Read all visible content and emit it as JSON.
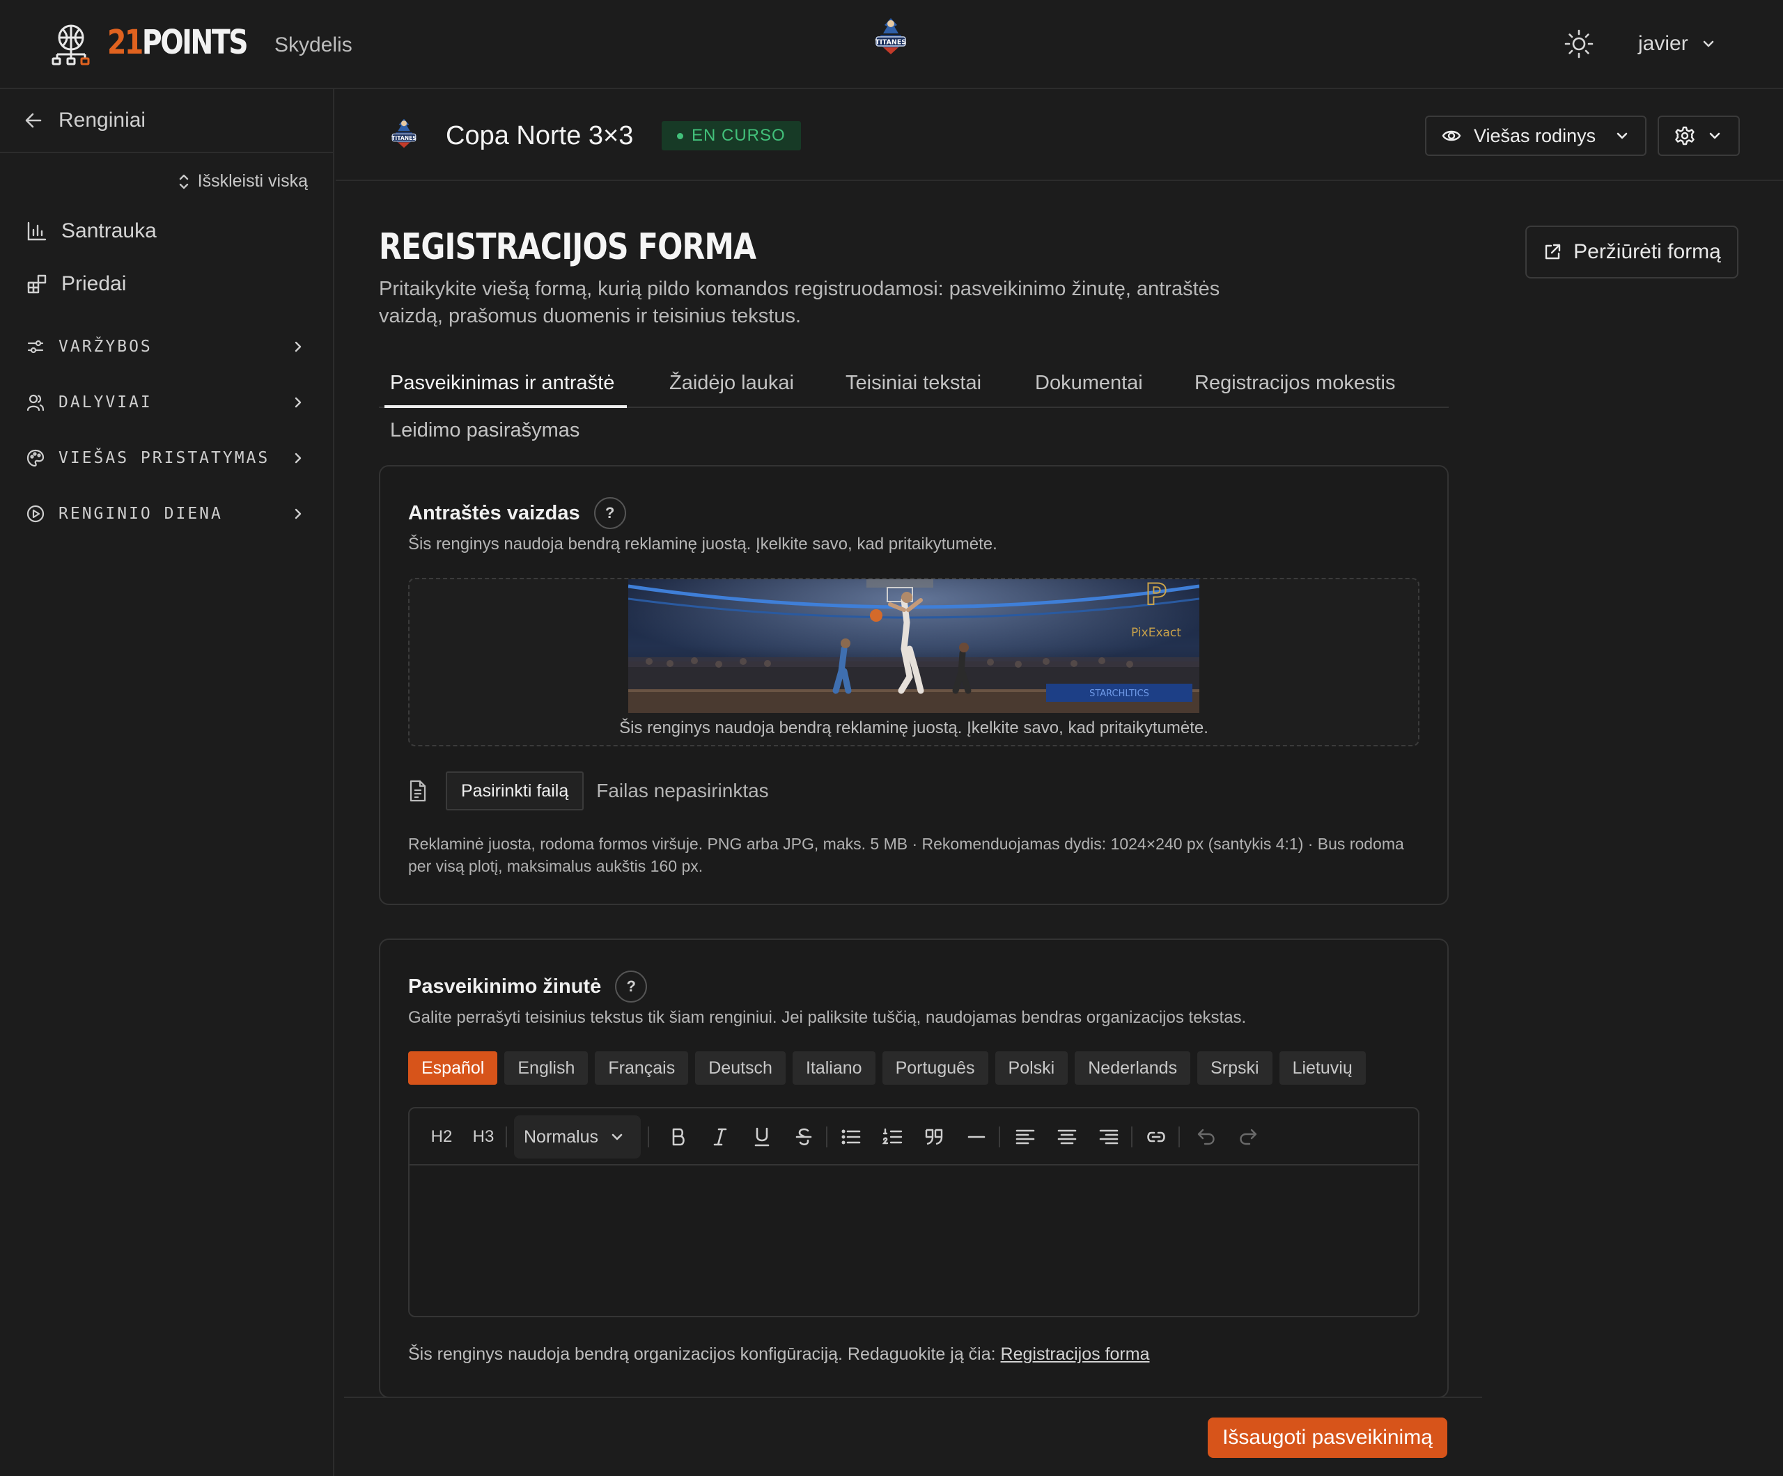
{
  "topbar": {
    "brand_number": "21",
    "brand_word": "POINTS",
    "nav_dashboard": "Skydelis",
    "user_name": "javier"
  },
  "sidebar": {
    "back_label": "Renginiai",
    "expand_all": "Išskleisti viską",
    "items": [
      {
        "label": "Santrauka",
        "icon": "bar-chart-icon"
      },
      {
        "label": "Priedai",
        "icon": "add-blocks-icon"
      }
    ],
    "groups": [
      {
        "label": "VARŽYBOS",
        "icon": "sliders-icon"
      },
      {
        "label": "DALYVIAI",
        "icon": "users-icon"
      },
      {
        "label": "VIEŠAS PRISTATYMAS",
        "icon": "palette-icon"
      },
      {
        "label": "RENGINIO DIENA",
        "icon": "play-circle-icon"
      }
    ]
  },
  "event": {
    "title": "Copa Norte 3×3",
    "status": "EN CURSO",
    "public_view_label": "Viešas rodinys"
  },
  "page": {
    "title": "REGISTRACIJOS FORMA",
    "description": "Pritaikykite viešą formą, kurią pildo komandos registruodamosi: pasveikinimo žinutę, antraštės vaizdą, prašomus duomenis ir teisinius tekstus.",
    "preview_form_label": "Peržiūrėti formą"
  },
  "tabs": [
    {
      "label": "Pasveikinimas ir antraštė",
      "active": true
    },
    {
      "label": "Žaidėjo laukai",
      "active": false
    },
    {
      "label": "Teisiniai tekstai",
      "active": false
    },
    {
      "label": "Dokumentai",
      "active": false
    },
    {
      "label": "Registracijos mokestis",
      "active": false
    },
    {
      "label": "Leidimo pasirašymas",
      "active": false
    }
  ],
  "header_image_card": {
    "title": "Antraštės vaizdas",
    "help": "?",
    "subtitle": "Šis renginys naudoja bendrą reklaminę juostą. Įkelkite savo, kad pritaikytumėte.",
    "banner_watermark": "PixExact",
    "dropzone_caption": "Šis renginys naudoja bendrą reklaminę juostą. Įkelkite savo, kad pritaikytumėte.",
    "choose_file_label": "Pasirinkti failą",
    "no_file_label": "Failas nepasirinktas",
    "help_text": "Reklaminė juosta, rodoma formos viršuje. PNG arba JPG, maks. 5 MB · Rekomenduojamas dydis: 1024×240 px (santykis 4:1) · Bus rodoma per visą plotį, maksimalus aukštis 160 px."
  },
  "welcome_card": {
    "title": "Pasveikinimo žinutė",
    "help": "?",
    "subtitle": "Galite perrašyti teisinius tekstus tik šiam renginiui. Jei paliksite tuščią, naudojamas bendras organizacijos tekstas.",
    "languages": [
      {
        "label": "Español",
        "active": true
      },
      {
        "label": "English",
        "active": false
      },
      {
        "label": "Français",
        "active": false
      },
      {
        "label": "Deutsch",
        "active": false
      },
      {
        "label": "Italiano",
        "active": false
      },
      {
        "label": "Português",
        "active": false
      },
      {
        "label": "Polski",
        "active": false
      },
      {
        "label": "Nederlands",
        "active": false
      },
      {
        "label": "Srpski",
        "active": false
      },
      {
        "label": "Lietuvių",
        "active": false
      }
    ],
    "toolbar": {
      "h2": "H2",
      "h3": "H3",
      "paragraph_style": "Normalus"
    },
    "org_note": "Šis renginys naudoja bendrą organizacijos konfigūraciją. Redaguokite ją čia:",
    "org_link": "Registracijos forma"
  },
  "footer": {
    "save_label": "Išsaugoti pasveikinimą"
  },
  "colors": {
    "accent": "#d7541a",
    "status_bg": "#173a26",
    "status_fg": "#42c07a",
    "background": "#1c1c1c"
  }
}
